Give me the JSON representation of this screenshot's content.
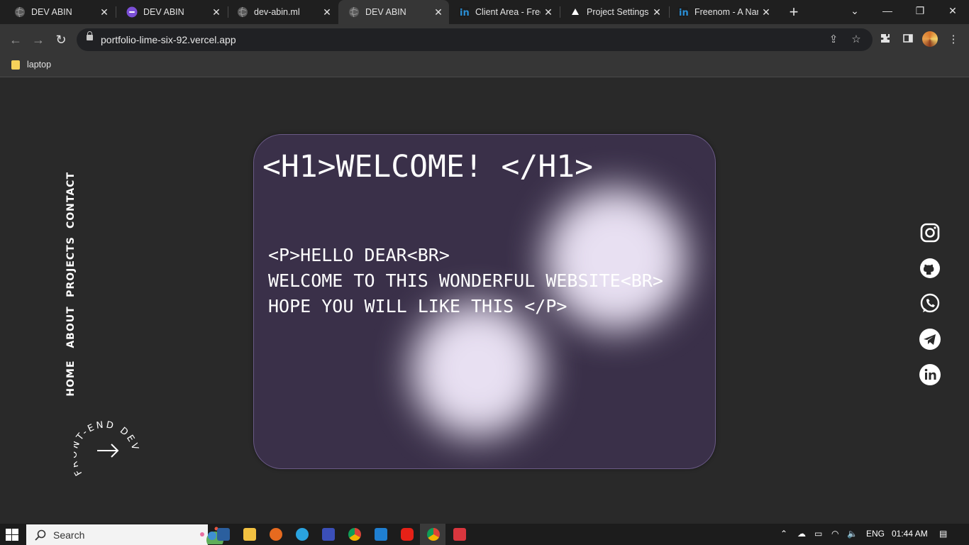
{
  "browser": {
    "tabs": [
      {
        "title": "DEV ABIN",
        "favicon": "globe-icon"
      },
      {
        "title": "DEV ABIN",
        "favicon": "purple-app-icon"
      },
      {
        "title": "dev-abin.ml",
        "favicon": "globe-icon"
      },
      {
        "title": "DEV ABIN",
        "favicon": "globe-icon"
      },
      {
        "title": "Client Area - Freenom",
        "favicon": "freenom-icon"
      },
      {
        "title": "Project Settings – Vercel",
        "favicon": "vercel-icon"
      },
      {
        "title": "Freenom - A Name for Everyone",
        "favicon": "freenom-icon"
      }
    ],
    "active_tab_index": 3,
    "url": "portfolio-lime-six-92.vercel.app",
    "bookmarks": [
      {
        "label": "laptop",
        "icon": "folder-icon"
      }
    ]
  },
  "site": {
    "nav": [
      "HOME",
      "ABOUT",
      "PROJECTS",
      "CONTACT"
    ],
    "badge_text": "FRONT-END DEV",
    "heading": "<H1>WELCOME! </H1>",
    "paragraph_lines": [
      "<P>HELLO DEAR<BR>",
      "WELCOME TO THIS WONDERFUL WEBSITE<BR>",
      "HOPE YOU WILL LIKE THIS </P>"
    ],
    "social": [
      "instagram-icon",
      "github-icon",
      "whatsapp-icon",
      "telegram-icon",
      "linkedin-icon"
    ],
    "colors": {
      "background": "#292929",
      "card": "#3a3049",
      "card_border": "#6a5a86",
      "glow": "#e8e0f2"
    }
  },
  "taskbar": {
    "search_placeholder": "Search",
    "language": "ENG",
    "time": "01:44 AM"
  }
}
